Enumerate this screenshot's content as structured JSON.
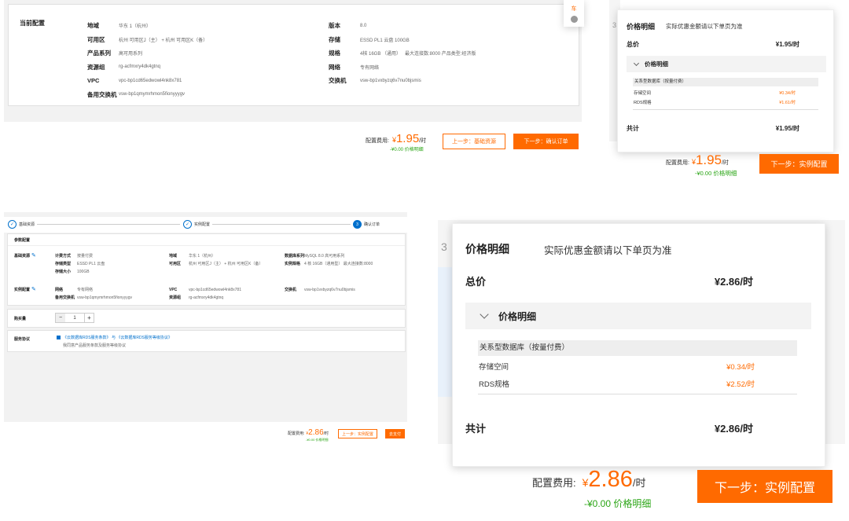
{
  "summary": {
    "section_title": "当前配置",
    "left_rows": [
      {
        "label": "地域",
        "value": "华东 1（杭州）"
      },
      {
        "label": "可用区",
        "value": "杭州 可用区J（主） + 杭州 可用区K（备）"
      },
      {
        "label": "产品系列",
        "value": "高可用系列"
      },
      {
        "label": "资源组",
        "value": "rg-acfmxry4dk4gtnq"
      },
      {
        "label": "VPC",
        "value": "vpc-bp1cd65edwowl4nk8x781"
      },
      {
        "label": "备用交换机",
        "value": "vsw-bp1qmymrhmon5fionyyygv"
      }
    ],
    "right_rows": [
      {
        "label": "版本",
        "value": "8.0"
      },
      {
        "label": "存储",
        "value": "ESSD PL1 云盘 100GB"
      },
      {
        "label": "规格",
        "value": "4核 16GB （通用）   最大连接数:8000 产品类型:经济版"
      },
      {
        "label": "网络",
        "value": "专有网络"
      },
      {
        "label": "交换机",
        "value": "vsw-bp1vxbyzq6v7nu0bjsmis"
      }
    ],
    "fee_label": "配置费用:",
    "fee_currency": "¥",
    "fee_value": "1.95",
    "fee_unit": "/时",
    "discount": "-¥0.00 价格明细",
    "prev_button": "上一步：基础资源",
    "next_button": "下一步：确认订单",
    "floating_icon": "cart-icon",
    "floating_text": "车"
  },
  "price_popup_small": {
    "title": "价格明细",
    "note": "实际优惠金额请以下单页为准",
    "total_label": "总价",
    "total_value": "¥1.95/时",
    "detail_label": "价格明细",
    "category": "关系型数据库（按量付费）",
    "items": [
      {
        "name": "存储空间",
        "price": "¥0.34/时"
      },
      {
        "name": "RDS规格",
        "price": "¥1.61/时"
      }
    ],
    "sum_label": "共计",
    "sum_value": "¥1.95/时",
    "bg_number": "3",
    "fee_label": "配置费用:",
    "fee_currency": "¥",
    "fee_value": "1.95",
    "fee_unit": "/时",
    "discount": "-¥0.00 价格明细",
    "next_button": "下一步：实例配置"
  },
  "order_page": {
    "steps": [
      {
        "label": "基础资源",
        "state": "done"
      },
      {
        "label": "实例配置",
        "state": "done"
      },
      {
        "label": "确认订单",
        "state": "current",
        "number": "3"
      }
    ],
    "section_title": "参数配置",
    "basic_group": "基础资源",
    "basic_col1": [
      {
        "label": "计费方式",
        "value": "按量付费"
      },
      {
        "label": "存储类型",
        "value": "ESSD PL1 云盘"
      },
      {
        "label": "存储大小",
        "value": "100GB"
      }
    ],
    "basic_col2": [
      {
        "label": "地域",
        "value": "华东 1（杭州）"
      },
      {
        "label": "可用区",
        "value": "杭州 可用区J（主） + 杭州 可用区K（备）"
      }
    ],
    "basic_col3": [
      {
        "label": "数据库系列",
        "value": "MySQL 8.0 高可用系列"
      },
      {
        "label": "实例规格",
        "value": "4 核 16GB（通用型）  最大连接数:8000"
      }
    ],
    "instance_group": "实例配置",
    "instance_col1": [
      {
        "label": "网络",
        "value": "专有网络"
      },
      {
        "label": "备用交换机",
        "value": "vsw-bp1qmymrhmon5fionyyygv"
      }
    ],
    "instance_col2": [
      {
        "label": "VPC",
        "value": "vpc-bp1cd65edwowl4nk8x781"
      },
      {
        "label": "资源组",
        "value": "rg-acfmxry4dk4gtnq"
      }
    ],
    "instance_col3": [
      {
        "label": "交换机",
        "value": "vsw-bp1vxbyzq6v7nu0bjsmis"
      }
    ],
    "quantity_label": "购买量",
    "quantity_value": "1",
    "minus": "−",
    "plus": "+",
    "agreement_label": "服务协议",
    "agreement_text": "《云数据库RDS服务条款》 与 《云数据库RDS服务等级协议》",
    "agreement_sub": "我同意产品服务条款及服务等级协议",
    "fee_label": "配置费用:",
    "fee_currency": "¥",
    "fee_value": "2.86",
    "fee_unit": "/时",
    "discount": "-¥0.00 价格明细",
    "prev_button": "上一步：实例配置",
    "submit_button": "去支付"
  },
  "price_popup_large": {
    "title": "价格明细",
    "note": "实际优惠金额请以下单页为准",
    "total_label": "总价",
    "total_value": "¥2.86/时",
    "detail_label": "价格明细",
    "category": "关系型数据库（按量付费）",
    "items": [
      {
        "name": "存储空间",
        "price": "¥0.34/时"
      },
      {
        "name": "RDS规格",
        "price": "¥2.52/时"
      }
    ],
    "sum_label": "共计",
    "sum_value": "¥2.86/时",
    "bg_number": "3",
    "fee_label": "配置费用:",
    "fee_currency": "¥",
    "fee_value": "2.86",
    "fee_unit": "/时",
    "discount": "-¥0.00 价格明细",
    "next_button": "下一步：实例配置"
  },
  "colors": {
    "accent": "#ff6a00",
    "green": "#2aa515",
    "step_blue": "#0070cc"
  }
}
